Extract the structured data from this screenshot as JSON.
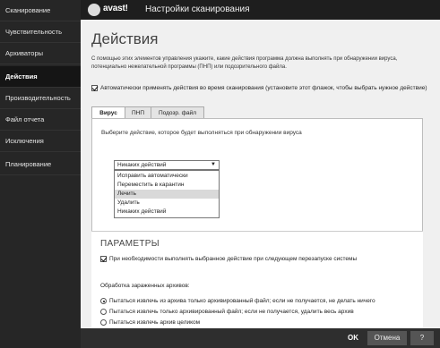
{
  "sidebar": {
    "items": [
      {
        "label": "Сканирование"
      },
      {
        "label": "Чувствительность"
      },
      {
        "label": "Архиваторы"
      },
      {
        "label": "Действия"
      },
      {
        "label": "Производительность"
      },
      {
        "label": "Файл отчета"
      },
      {
        "label": "Исключения"
      },
      {
        "label": "Планирование"
      }
    ],
    "active_index": 3
  },
  "titlebar": {
    "logo": "avast!",
    "title": "Настройки сканирования"
  },
  "main": {
    "heading": "Действия",
    "description": "С помощью этих элементов управления укажите, какие действия программа должна выполнять при обнаружении вируса, потенциально нежелательной программы (ПНП) или подозрительного файла.",
    "auto_apply": {
      "checked": true,
      "label": "Автоматически применять действия во время сканирования (установите этот флажок, чтобы выбрать нужное действие)"
    },
    "tabs": [
      {
        "label": "Вирус"
      },
      {
        "label": "ПНП"
      },
      {
        "label": "Подозр. файл"
      }
    ],
    "panel_text": "Выберите действие, которое будет выполняться при обнаружении вируса",
    "select": {
      "value": "Никаких действий",
      "options": [
        {
          "label": "Исправить автоматически"
        },
        {
          "label": "Переместить в карантин"
        },
        {
          "label": "Лечить"
        },
        {
          "label": "Удалить"
        },
        {
          "label": "Никаких действий"
        }
      ],
      "highlighted_index": 2
    }
  },
  "params": {
    "heading": "ПАРАМЕТРЫ",
    "restart": {
      "checked": true,
      "label": "При необходимости выполнять выбранное действие при следующем перезапуске системы"
    },
    "archives_label": "Обработка зараженных архивов:",
    "radios": [
      {
        "label": "Пытаться извлечь из архива только архивированный файл; если не получается, не делать ничего",
        "checked": true
      },
      {
        "label": "Пытаться извлечь только архивированный файл; если не получается, удалить весь архив",
        "checked": false
      },
      {
        "label": "Пытаться извлечь архив целиком",
        "checked": false
      }
    ]
  },
  "footer": {
    "ok": "OK",
    "cancel": "Отмена",
    "help": "?"
  }
}
